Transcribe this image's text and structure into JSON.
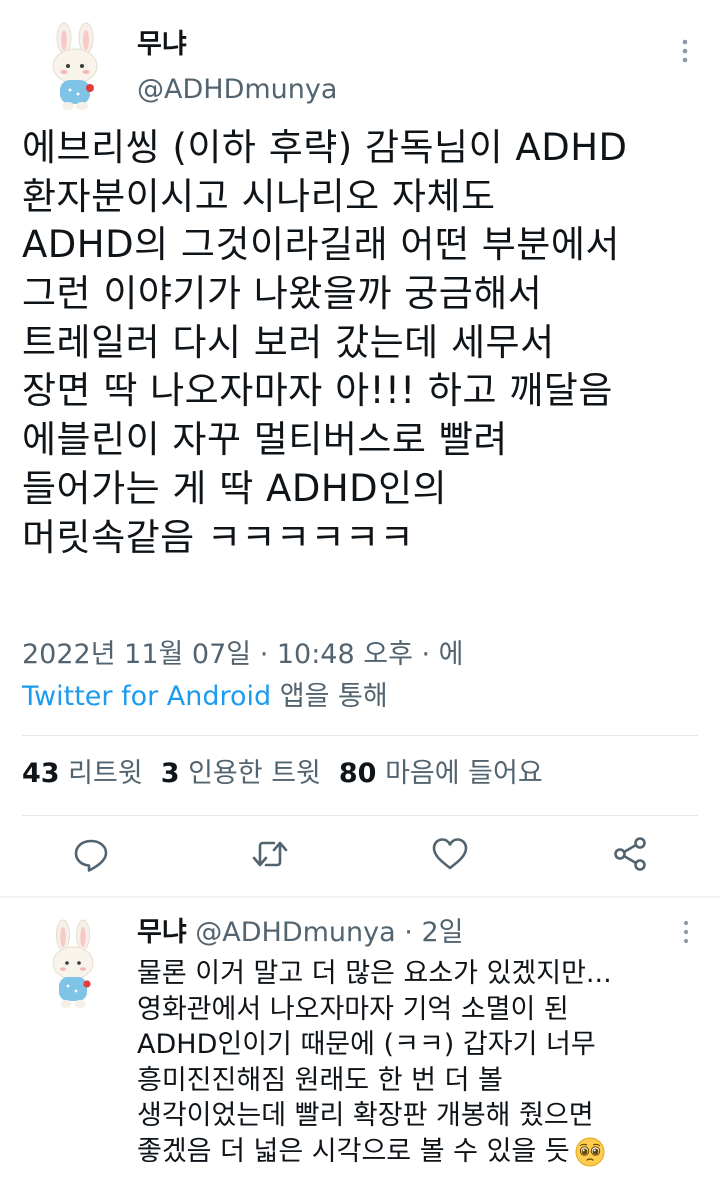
{
  "tweet": {
    "display_name": "무냐",
    "handle": "@ADHDmunya",
    "body_lines": [
      "에브리씽 (이하 후략) 감독님이 ADHD",
      "환자분이시고 시나리오 자체도",
      "ADHD의 그것이라길래 어떤 부분에서",
      "그런 이야기가 나왔을까 궁금해서",
      "트레일러 다시 보러 갔는데 세무서",
      "장면 딱 나오자마자 아!!! 하고 깨달음",
      "에블린이 자꾸 멀티버스로 빨려",
      "들어가는 게 딱 ADHD인의",
      "머릿속같음 ㅋㅋㅋㅋㅋㅋ"
    ],
    "timestamp": "2022년 11월 07일 · 10:48 오후 · 에",
    "source_app": "Twitter for Android",
    "source_suffix": " 앱을 통해",
    "stats": {
      "retweets_count": "43",
      "retweets_label": "리트윗",
      "quotes_count": "3",
      "quotes_label": "인용한 트윗",
      "likes_count": "80",
      "likes_label": "마음에 들어요"
    }
  },
  "reply": {
    "display_name": "무냐",
    "handle": "@ADHDmunya",
    "time": "· 2일",
    "body_lines": [
      "물론 이거 말고 더 많은 요소가 있겠지만...",
      "영화관에서 나오자마자 기억 소멸이 된",
      "ADHD인이기 때문에 (ㅋㅋ) 갑자기 너무",
      "흥미진진해짐 원래도 한 번 더 볼",
      "생각이었는데 빨리 확장판 개봉해 줬으면",
      "좋겠음 더 넓은 시각으로 볼 수 있을 듯"
    ],
    "emoji": "pleading-face-emoji"
  },
  "icons": {
    "more": "more-vertical-icon",
    "reply": "reply-icon",
    "retweet": "retweet-icon",
    "like": "heart-icon",
    "share": "share-icon"
  },
  "colors": {
    "text": "#0f1419",
    "secondary": "#536471",
    "accent": "#1d9bf0",
    "divider": "#eff3f4"
  }
}
